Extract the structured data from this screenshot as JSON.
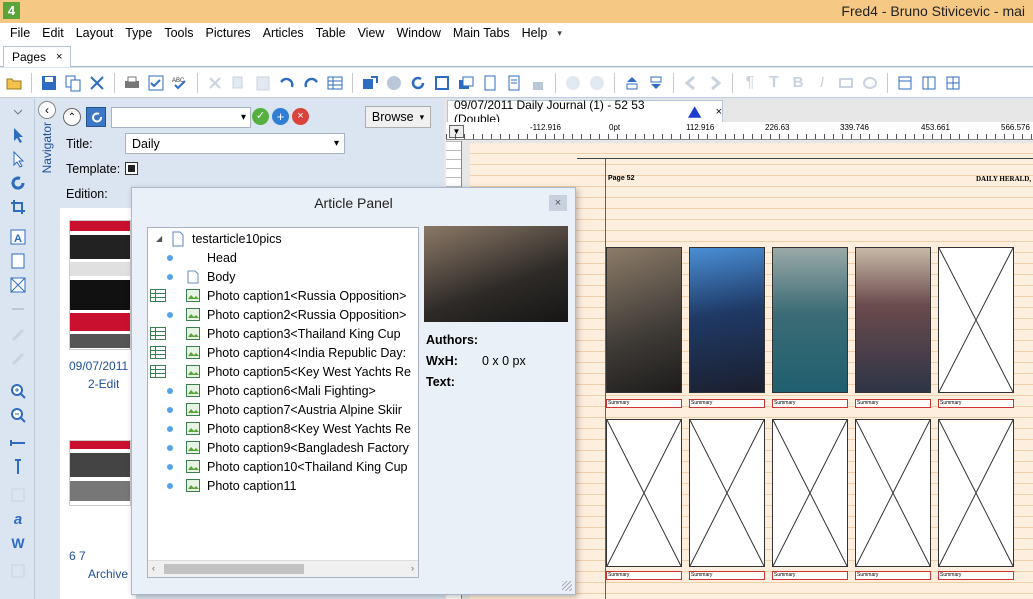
{
  "window": {
    "title": "Fred4 - Bruno Stivicevic - mai",
    "icon_text": "4"
  },
  "menu": [
    "File",
    "Edit",
    "Layout",
    "Type",
    "Tools",
    "Pictures",
    "Articles",
    "Table",
    "View",
    "Window",
    "Main Tabs",
    "Help"
  ],
  "tabs": {
    "pages_label": "Pages",
    "close": "×"
  },
  "navigator": {
    "label": "Navigator",
    "browse_label": "Browse",
    "title_label": "Title:",
    "title_value": "Daily",
    "template_label": "Template:",
    "edition_label": "Edition:"
  },
  "thumbs": [
    {
      "date": "09/07/2011",
      "status": "2-Edit"
    },
    {
      "pages": "6 7",
      "status": "Archive"
    }
  ],
  "document": {
    "tab_label": "09/07/2011 Daily Journal (1) - 52 53 (Double)",
    "tab_close": "×",
    "ruler_marks": [
      "-112.916",
      "0pt",
      "112.916",
      "226.63",
      "339.746",
      "453.661",
      "566.576"
    ],
    "page_label": "Page 52",
    "masthead": "DAILY HERALD,",
    "summary_label": "Summary"
  },
  "article_panel": {
    "title": "Article Panel",
    "close": "×",
    "root": "testarticle10pics",
    "items": [
      {
        "label": "Head",
        "type": "dot"
      },
      {
        "label": "Body",
        "type": "page"
      },
      {
        "label": "Photo caption1<Russia Opposition>",
        "type": "table-pic"
      },
      {
        "label": "Photo caption2<Russia Opposition>",
        "type": "dot-pic"
      },
      {
        "label": "Photo caption3<Thailand King Cup",
        "type": "table-pic"
      },
      {
        "label": "Photo caption4<India Republic Day:",
        "type": "table-pic"
      },
      {
        "label": "Photo caption5<Key West Yachts Re",
        "type": "table-pic"
      },
      {
        "label": "Photo caption6<Mali Fighting>",
        "type": "dot-pic"
      },
      {
        "label": "Photo caption7<Austria Alpine Skiir",
        "type": "dot-pic"
      },
      {
        "label": "Photo caption8<Key West Yachts Re",
        "type": "dot-pic"
      },
      {
        "label": "Photo caption9<Bangladesh Factory",
        "type": "dot-pic"
      },
      {
        "label": "Photo caption10<Thailand King Cup",
        "type": "dot-pic"
      },
      {
        "label": "Photo caption11",
        "type": "dot-pic"
      }
    ],
    "authors_label": "Authors:",
    "wxh_label": "WxH:",
    "wxh_value": "0 x 0 px",
    "text_label": "Text:"
  },
  "colors": {
    "titlebar": "#f5c983",
    "accent": "#1e4f9a",
    "page_bg": "#fdeedd",
    "panel_bg": "#eaf0f8"
  }
}
